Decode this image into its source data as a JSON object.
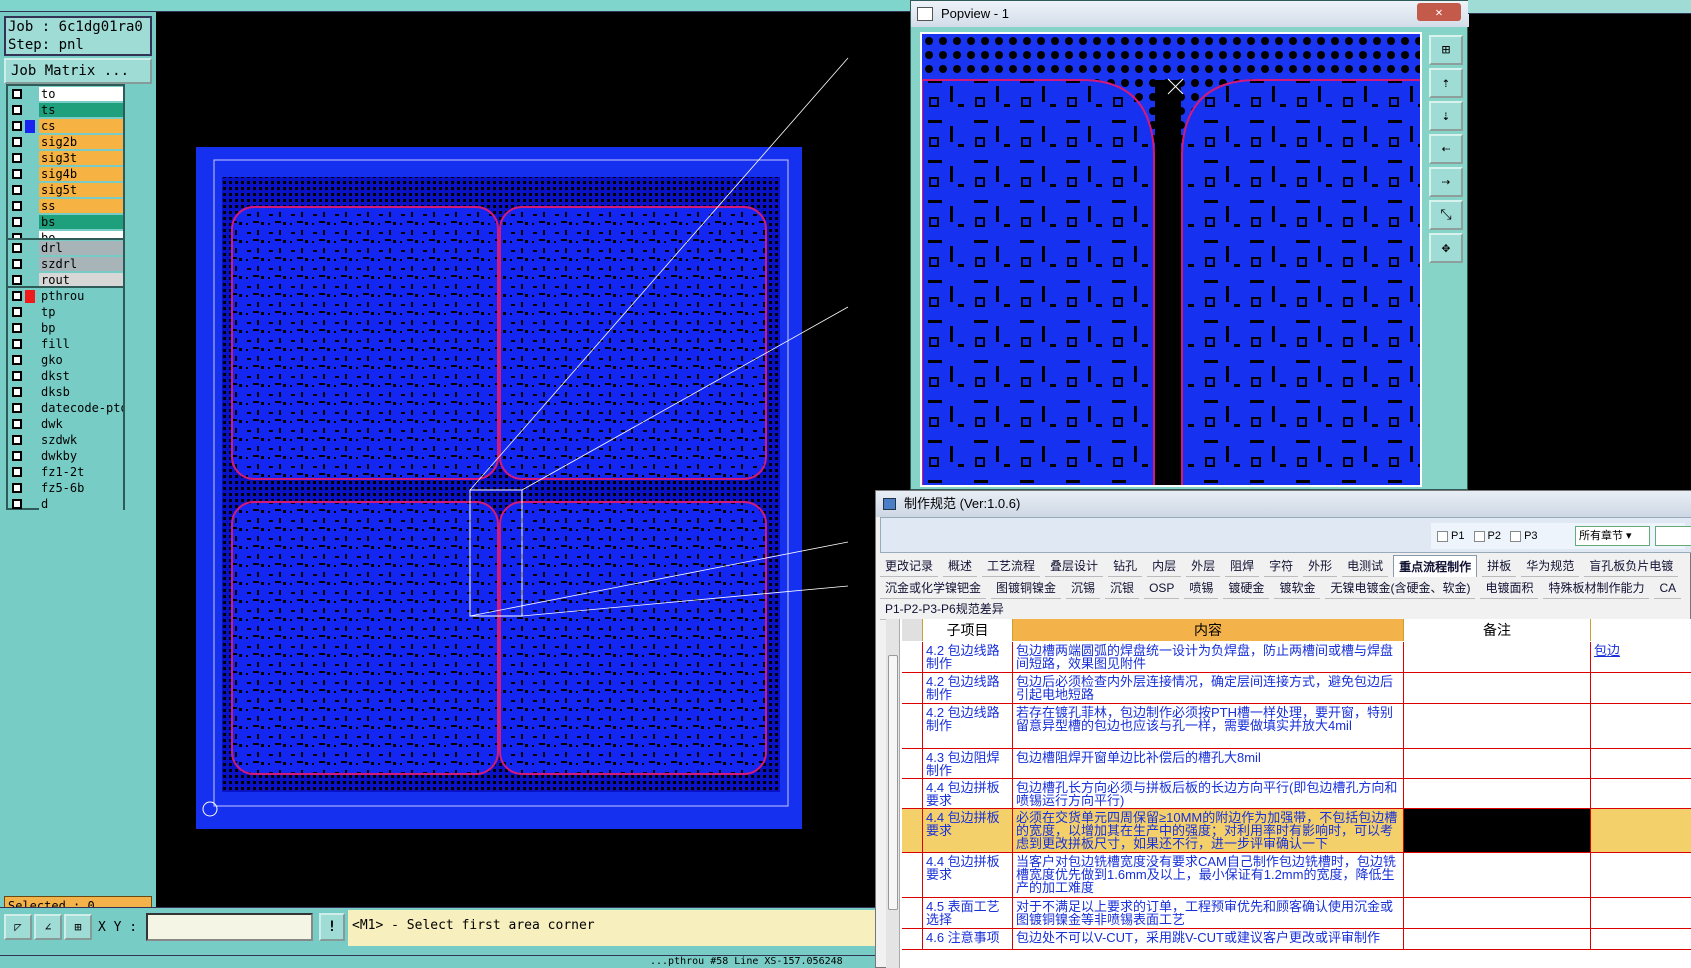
{
  "job": {
    "job_line": "Job : 6c1dg01ra0",
    "step_line": "Step: pnl",
    "matrix_button": "Job Matrix ..."
  },
  "layers": {
    "group1": [
      {
        "name": "to",
        "color": "#ffffff"
      },
      {
        "name": "ts",
        "color": "#1fa07c"
      },
      {
        "name": "cs",
        "color": "#f6b343"
      },
      {
        "name": "sig2b",
        "color": "#f6b343"
      },
      {
        "name": "sig3t",
        "color": "#f6b343"
      },
      {
        "name": "sig4b",
        "color": "#f6b343"
      },
      {
        "name": "sig5t",
        "color": "#f6b343"
      },
      {
        "name": "ss",
        "color": "#f6b343"
      },
      {
        "name": "bs",
        "color": "#1fa07c"
      },
      {
        "name": "bo",
        "color": "#ffffff"
      }
    ],
    "group2": [
      {
        "name": "drl",
        "color": "#a9b4b8"
      },
      {
        "name": "szdrl",
        "color": "#a9b4b8"
      },
      {
        "name": "rout",
        "color": "#d7d7d7"
      }
    ],
    "group3": [
      {
        "name": "pthrou",
        "color": "#77cdc5"
      },
      {
        "name": "tp",
        "color": "#77cdc5"
      },
      {
        "name": "bp",
        "color": "#77cdc5"
      },
      {
        "name": "fill",
        "color": "#77cdc5"
      },
      {
        "name": "gko",
        "color": "#77cdc5"
      },
      {
        "name": "dkst",
        "color": "#77cdc5"
      },
      {
        "name": "dksb",
        "color": "#77cdc5"
      },
      {
        "name": "datecode-pto",
        "color": "#77cdc5"
      },
      {
        "name": "dwk",
        "color": "#77cdc5"
      },
      {
        "name": "szdwk",
        "color": "#77cdc5"
      },
      {
        "name": "dwkby",
        "color": "#77cdc5"
      },
      {
        "name": "fz1-2t",
        "color": "#77cdc5"
      },
      {
        "name": "fz5-6b",
        "color": "#77cdc5"
      },
      {
        "name": "d",
        "color": "#77cdc5"
      }
    ]
  },
  "selected_text": "Selected : 0",
  "toolbar": {
    "xy_label": "X Y :",
    "bang": "!",
    "message": "<M1> - Select first area corner"
  },
  "status_text": "...pthrou #58 Line XS-157.056248",
  "popview": {
    "title": "Popview - 1",
    "close": "✕"
  },
  "spec": {
    "title": "制作规范 (Ver:1.0.6)",
    "p1": "P1",
    "p2": "P2",
    "p3": "P3",
    "chapter": "所有章节 ▾",
    "tabs1": [
      "更改记录",
      "概述",
      "工艺流程",
      "叠层设计",
      "钻孔",
      "内层",
      "外层",
      "阻焊",
      "字符",
      "外形",
      "电测试",
      "重点流程制作",
      "拼板",
      "华为规范",
      "盲孔板负片电镀"
    ],
    "tabs2": [
      "沉金或化学镍钯金",
      "图镀铜镍金",
      "沉锡",
      "沉银",
      "OSP",
      "喷锡",
      "镀硬金",
      "镀软金",
      "无镍电镀金(含硬金、软金)",
      "电镀面积",
      "特殊板材制作能力",
      "CA"
    ],
    "tabs3": [
      "P1-P2-P3-P6规范差异"
    ],
    "active_tab": "重点流程制作",
    "headers": {
      "sub": "子项目",
      "content": "内容",
      "note": "备注"
    },
    "rows": [
      {
        "sub": "4.2 包边线路制作",
        "content": "包边槽两端圆弧的焊盘统一设计为负焊盘，防止两槽间或槽与焊盘间短路，效果图见附件",
        "extra": "包边"
      },
      {
        "sub": "4.2 包边线路制作",
        "content": "包边后必须检查内外层连接情况，确定层间连接方式，避免包边后引起电地短路",
        "extra": ""
      },
      {
        "sub": "4.2 包边线路制作",
        "content": "若存在镀孔菲林，包边制作必须按PTH槽一样处理，要开窗，特别留意异型槽的包边也应该与孔一样，需要做填实并放大4mil",
        "extra": ""
      },
      {
        "sub": "4.3 包边阻焊制作",
        "content": "包边槽阻焊开窗单边比补偿后的槽孔大8mil",
        "extra": ""
      },
      {
        "sub": "4.4 包边拼板要求",
        "content": "包边槽孔长方向必须与拼板后板的长边方向平行(即包边槽孔方向和喷锡运行方向平行)",
        "extra": ""
      },
      {
        "sub": "4.4 包边拼板要求",
        "content": "必须在交货单元四周保留≥10MM的附边作为加强带，不包括包边槽的宽度，以增加其在生产中的强度；对利用率时有影响时，可以考虑到更改拼板尺寸，如果还不行，进一步评审确认一下",
        "extra": ""
      },
      {
        "sub": "4.4 包边拼板要求",
        "content": "当客户对包边铣槽宽度没有要求CAM自己制作包边铣槽时，包边铣槽宽度优先做到1.6mm及以上，最小保证有1.2mm的宽度，降低生产的加工难度",
        "extra": ""
      },
      {
        "sub": "4.5 表面工艺选择",
        "content": "对于不满足以上要求的订单，工程预审优先和顾客确认使用沉金或图镀铜镍金等非喷锡表面工艺",
        "extra": ""
      },
      {
        "sub": "4.6 注意事项",
        "content": "包边处不可以V-CUT，采用跳V-CUT或建议客户更改或评审制作",
        "extra": ""
      }
    ]
  }
}
